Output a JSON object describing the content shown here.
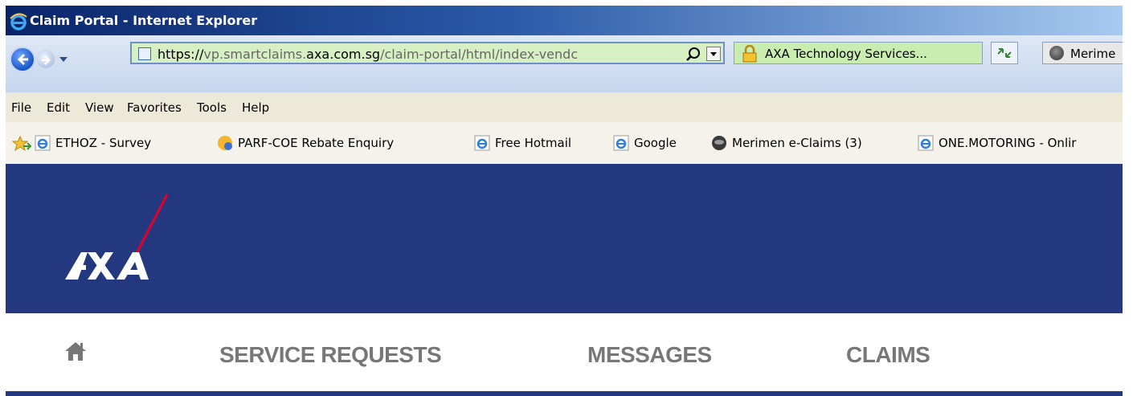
{
  "window": {
    "title": "Claim Portal - Internet Explorer"
  },
  "address_bar": {
    "url_scheme": "https://",
    "url_prefix": "vp.smartclaims.",
    "url_domain": "axa.com.sg",
    "url_path": "/claim-portal/html/index-vendc"
  },
  "certificate": {
    "label": "AXA Technology Services..."
  },
  "tab": {
    "label": "Merime"
  },
  "menu": [
    "File",
    "Edit",
    "View",
    "Favorites",
    "Tools",
    "Help"
  ],
  "favorites": [
    {
      "label": "ETHOZ - Survey",
      "icon": "ie-page-icon"
    },
    {
      "label": "PARF-COE Rebate Enquiry",
      "icon": "onemotoring-icon"
    },
    {
      "label": "Free Hotmail",
      "icon": "ie-page-icon"
    },
    {
      "label": "Google",
      "icon": "ie-page-icon"
    },
    {
      "label": "Merimen e-Claims (3)",
      "icon": "globe-icon"
    },
    {
      "label": "ONE.MOTORING - Onlir",
      "icon": "ie-page-icon"
    }
  ],
  "brand": {
    "logo_text": "AXA",
    "banner_color": "#24387f",
    "accent_red": "#e4002b"
  },
  "nav": {
    "home_icon": "home-icon",
    "items": [
      "SERVICE REQUESTS",
      "MESSAGES",
      "CLAIMS"
    ]
  }
}
